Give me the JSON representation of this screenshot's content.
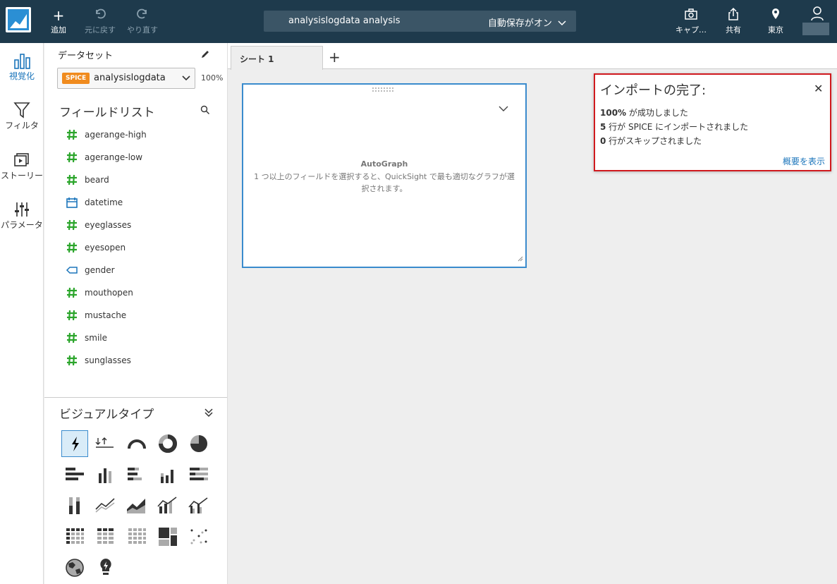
{
  "topbar": {
    "add_label": "追加",
    "undo_label": "元に戻す",
    "redo_label": "やり直す",
    "analysis_title": "analysislogdata analysis",
    "autosave_label": "自動保存がオン",
    "capture_label": "キャプ…",
    "share_label": "共有",
    "region_label": "東京"
  },
  "rail": {
    "visualize": "視覚化",
    "filter": "フィルタ",
    "story": "ストーリー",
    "parameters": "パラメータ"
  },
  "dataset": {
    "label": "データセット",
    "badge": "SPICE",
    "name": "analysislogdata",
    "percent": "100%"
  },
  "field_list": {
    "title": "フィールドリスト",
    "fields": [
      {
        "name": "agerange-high",
        "type": "number"
      },
      {
        "name": "agerange-low",
        "type": "number"
      },
      {
        "name": "beard",
        "type": "number"
      },
      {
        "name": "datetime",
        "type": "date"
      },
      {
        "name": "eyeglasses",
        "type": "number"
      },
      {
        "name": "eyesopen",
        "type": "number"
      },
      {
        "name": "gender",
        "type": "string"
      },
      {
        "name": "mouthopen",
        "type": "number"
      },
      {
        "name": "mustache",
        "type": "number"
      },
      {
        "name": "smile",
        "type": "number"
      },
      {
        "name": "sunglasses",
        "type": "number"
      }
    ]
  },
  "visual_types": {
    "title": "ビジュアルタイプ",
    "icons": [
      "autograph-icon",
      "kpi-icon",
      "gauge-icon",
      "donut-icon",
      "pie-icon",
      "horizontal-bar-icon",
      "vertical-bar-icon",
      "horizontal-stacked-bar-icon",
      "vertical-stacked-bar-icon",
      "horizontal-100-bar-icon",
      "vertical-100-bar-icon",
      "line-icon",
      "area-icon",
      "combo-bar-line-icon",
      "combo-cluster-line-icon",
      "pivot-table-icon",
      "table-icon",
      "heatmap-icon",
      "tree-map-icon",
      "scatter-icon",
      "geo-map-icon",
      "insight-icon"
    ]
  },
  "sheet": {
    "tab_label": "シート 1"
  },
  "visual": {
    "title": "AutoGraph",
    "description": "1 つ以上のフィールドを選択すると、QuickSight で最も適切なグラフが選択されます。"
  },
  "notice": {
    "title": "インポートの完了:",
    "line1_strong": "100%",
    "line1_rest": " が成功しました",
    "line2_strong": "5",
    "line2_rest": " 行が SPICE にインポートされました",
    "line3_strong": "0",
    "line3_rest": " 行がスキップされました",
    "summary_link": "概要を表示"
  },
  "colors": {
    "topbar": "#1e3a4c",
    "accent": "#1b75bb",
    "number_field": "#2ba52b",
    "spice_badge": "#f08b1e",
    "notice_border": "#d0191e"
  }
}
